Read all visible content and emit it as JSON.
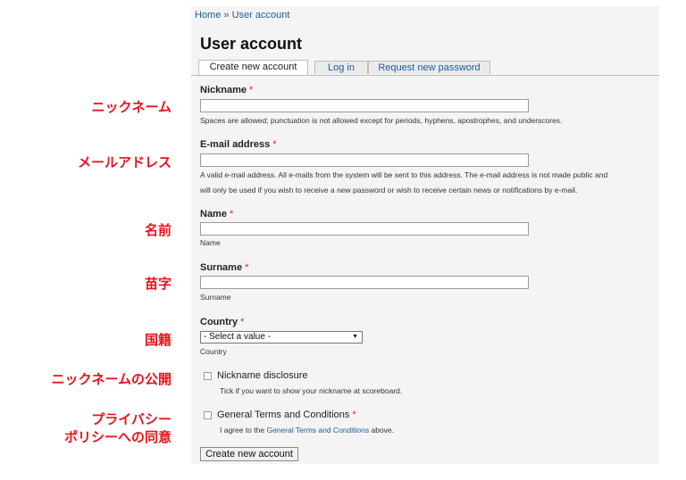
{
  "annotations": {
    "nickname": "ニックネーム",
    "email": "メールアドレス",
    "name": "名前",
    "surname": "苗字",
    "country": "国籍",
    "nickname_disclosure": "ニックネームの公開",
    "privacy_line1": "プライバシー",
    "privacy_line2": "ポリシーへの同意"
  },
  "breadcrumb": {
    "home": "Home",
    "separator": "»",
    "current": "User account"
  },
  "page_title": "User account",
  "tabs": [
    {
      "label": "Create new account",
      "active": true
    },
    {
      "label": "Log in",
      "active": false
    },
    {
      "label": "Request new password",
      "active": false
    }
  ],
  "required_mark": "*",
  "form": {
    "nickname": {
      "label": "Nickname",
      "value": "",
      "description": "Spaces are allowed; punctuation is not allowed except for periods, hyphens, apostrophes, and underscores."
    },
    "email": {
      "label": "E-mail address",
      "value": "",
      "description_line1": "A valid e-mail address. All e-mails from the system will be sent to this address. The e-mail address is not made public and",
      "description_line2": "will only be used if you wish to receive a new password or wish to receive certain news or notifications by e-mail."
    },
    "name": {
      "label": "Name",
      "value": "",
      "description": "Name"
    },
    "surname": {
      "label": "Surname",
      "value": "",
      "description": "Surname"
    },
    "country": {
      "label": "Country",
      "selected": "- Select a value -",
      "description": "Country"
    },
    "nickname_disclosure": {
      "label": "Nickname disclosure",
      "checked": false,
      "description": "Tick if you want to show your nickname at scoreboard."
    },
    "terms": {
      "label": "General Terms and Conditions",
      "checked": false,
      "description_prefix": "I agree to the",
      "description_link": "General Terms and Conditions",
      "description_suffix": "above."
    }
  },
  "submit_label": "Create new account"
}
